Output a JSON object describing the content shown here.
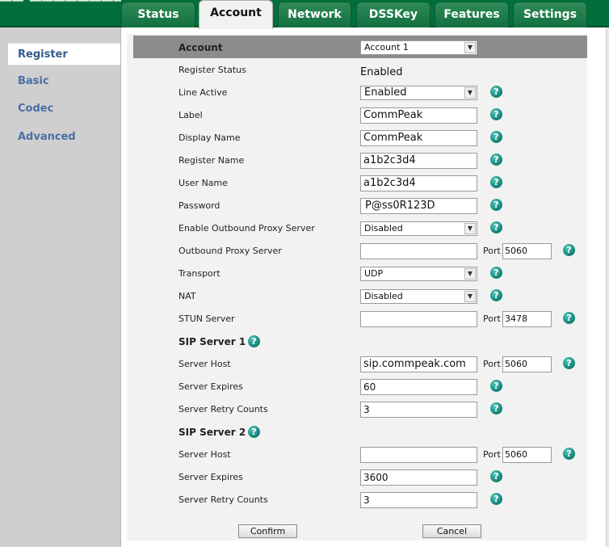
{
  "tabs": [
    {
      "label": "Status"
    },
    {
      "label": "Account"
    },
    {
      "label": "Network"
    },
    {
      "label": "DSSKey"
    },
    {
      "label": "Features"
    },
    {
      "label": "Settings"
    }
  ],
  "active_tab": "Account",
  "sidebar": {
    "items": [
      {
        "label": "Register"
      },
      {
        "label": "Basic"
      },
      {
        "label": "Codec"
      },
      {
        "label": "Advanced"
      }
    ],
    "active": "Register"
  },
  "form": {
    "account": {
      "label": "Account",
      "value": "Account 1"
    },
    "register_status": {
      "label": "Register Status",
      "value": "Enabled"
    },
    "line_active": {
      "label": "Line Active",
      "value": "Enabled"
    },
    "label": {
      "label": "Label",
      "value": "CommPeak"
    },
    "display_name": {
      "label": "Display Name",
      "value": "CommPeak"
    },
    "register_name": {
      "label": "Register Name",
      "value": "a1b2c3d4"
    },
    "user_name": {
      "label": "User Name",
      "value": "a1b2c3d4"
    },
    "password": {
      "label": "Password",
      "value": "P@ss0R123D"
    },
    "outbound_proxy_enable": {
      "label": "Enable Outbound Proxy Server",
      "value": "Disabled"
    },
    "outbound_proxy_server": {
      "label": "Outbound Proxy Server",
      "value": "",
      "port_label": "Port",
      "port": "5060"
    },
    "transport": {
      "label": "Transport",
      "value": "UDP"
    },
    "nat": {
      "label": "NAT",
      "value": "Disabled"
    },
    "stun_server": {
      "label": "STUN Server",
      "value": "",
      "port_label": "Port",
      "port": "3478"
    },
    "sip1": {
      "heading": "SIP Server 1",
      "host": {
        "label": "Server Host",
        "value": "sip.commpeak.com",
        "port_label": "Port",
        "port": "5060"
      },
      "expires": {
        "label": "Server Expires",
        "value": "60"
      },
      "retry": {
        "label": "Server Retry Counts",
        "value": "3"
      }
    },
    "sip2": {
      "heading": "SIP Server 2",
      "host": {
        "label": "Server Host",
        "value": "",
        "port_label": "Port",
        "port": "5060"
      },
      "expires": {
        "label": "Server Expires",
        "value": "3600"
      },
      "retry": {
        "label": "Server Retry Counts",
        "value": "3"
      }
    }
  },
  "buttons": {
    "confirm": "Confirm",
    "cancel": "Cancel"
  },
  "icons": {
    "help": "help-question-icon",
    "dropdown": "dropdown-arrow-icon"
  },
  "colors": {
    "header_green": "#006f3c",
    "tab_green": "#2e8b57",
    "sidebar_link": "#4a6fa5",
    "help_teal": "#0f7f74",
    "account_bar": "#8c8c8c"
  }
}
